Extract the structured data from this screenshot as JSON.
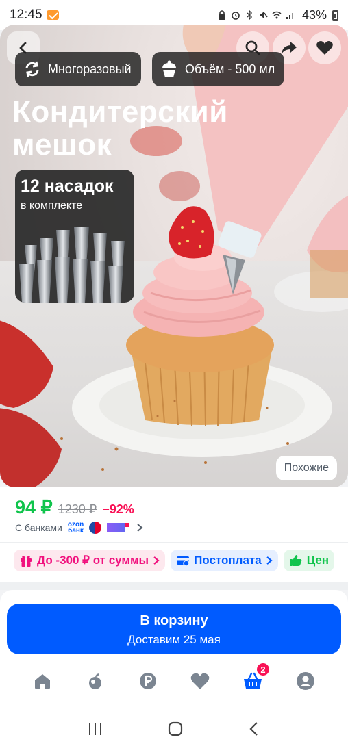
{
  "status_bar": {
    "time": "12:45",
    "battery": "43%",
    "icons": [
      "ozon-app-icon",
      "lock-icon",
      "alarm-icon",
      "bluetooth-icon",
      "mute-icon",
      "wifi-icon",
      "signal-icon",
      "battery-icon"
    ]
  },
  "hero": {
    "tags": [
      {
        "icon": "reusable-cycle-icon",
        "label": "Многоразовый"
      },
      {
        "icon": "cupcake-icon",
        "label": "Объём - 500 мл"
      }
    ],
    "title_line1": "Кондитерский",
    "title_line2": "мешок",
    "nozzle_card": {
      "title": "12 насадок",
      "subtitle": "в комплекте"
    },
    "similar_label": "Похожие",
    "actions": [
      "back-icon",
      "search-icon",
      "share-icon",
      "heart-icon"
    ]
  },
  "price": {
    "current": "94 ₽",
    "old": "1230 ₽",
    "discount": "−92%",
    "banks_label": "С банками",
    "ozon_bank_line1": "ozon",
    "ozon_bank_line2": "банк"
  },
  "chips": [
    {
      "icon": "gift-icon",
      "label": "До -300 ₽ от суммы",
      "color": "#f1117e"
    },
    {
      "icon": "card-icon",
      "label": "Постоплата",
      "color": "#005bff"
    },
    {
      "icon": "thumbs-up-icon",
      "label": "Цен",
      "color": "#10c44c"
    }
  ],
  "cart": {
    "label": "В корзину",
    "delivery": "Доставим 25 мая"
  },
  "tabbar": {
    "cart_badge": "2",
    "items": [
      "home-icon",
      "fresh-icon",
      "ruble-icon",
      "favorites-icon",
      "cart-icon",
      "profile-icon"
    ],
    "active_color": "#005bff"
  },
  "colors": {
    "brand_blue": "#005bff",
    "price_green": "#10c44c",
    "discount_pink": "#f91155"
  }
}
